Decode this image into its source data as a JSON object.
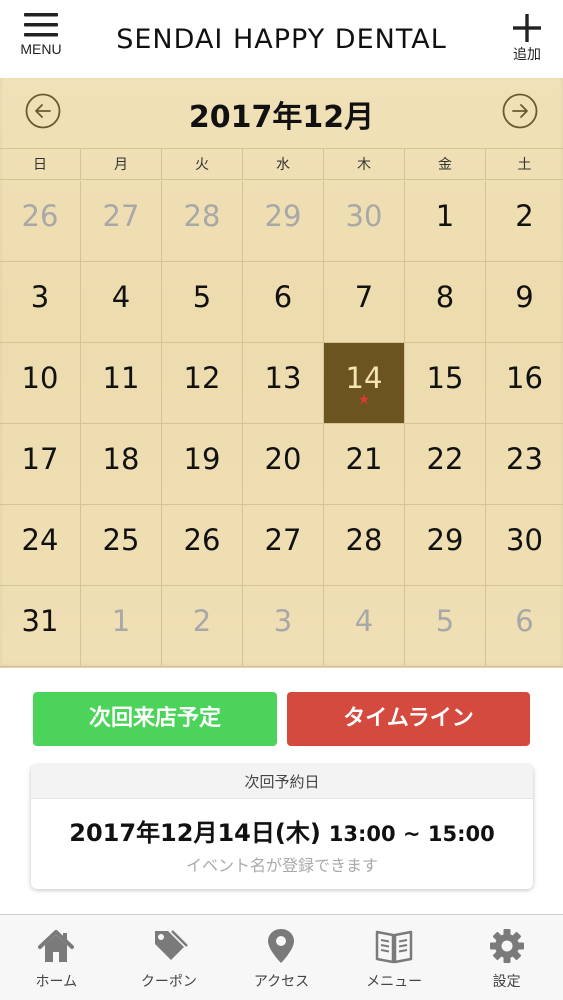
{
  "header": {
    "menu_label": "MENU",
    "title": "SENDAI HAPPY DENTAL",
    "add_label": "追加"
  },
  "calendar": {
    "month_title": "2017年12月",
    "weekdays": [
      "日",
      "月",
      "火",
      "水",
      "木",
      "金",
      "土"
    ],
    "weeks": [
      [
        "26",
        "27",
        "28",
        "29",
        "30",
        "1",
        "2"
      ],
      [
        "3",
        "4",
        "5",
        "6",
        "7",
        "8",
        "9"
      ],
      [
        "10",
        "11",
        "12",
        "13",
        "14",
        "15",
        "16"
      ],
      [
        "17",
        "18",
        "19",
        "20",
        "21",
        "22",
        "23"
      ],
      [
        "24",
        "25",
        "26",
        "27",
        "28",
        "29",
        "30"
      ],
      [
        "31",
        "1",
        "2",
        "3",
        "4",
        "5",
        "6"
      ]
    ],
    "other_month_cells": [
      [
        0,
        0
      ],
      [
        0,
        1
      ],
      [
        0,
        2
      ],
      [
        0,
        3
      ],
      [
        0,
        4
      ],
      [
        5,
        1
      ],
      [
        5,
        2
      ],
      [
        5,
        3
      ],
      [
        5,
        4
      ],
      [
        5,
        5
      ],
      [
        5,
        6
      ]
    ],
    "selected_cell": [
      2,
      4
    ],
    "marker": "★"
  },
  "buttons": {
    "next_visit": "次回来店予定",
    "timeline": "タイムライン"
  },
  "reservation": {
    "label": "次回予約日",
    "date": "2017年12月14日(木)",
    "time": "13:00 ~ 15:00",
    "event_placeholder": "イベント名が登録できます"
  },
  "tabbar": {
    "items": [
      {
        "label": "ホーム",
        "icon": "home-icon"
      },
      {
        "label": "クーポン",
        "icon": "coupon-tag-icon"
      },
      {
        "label": "アクセス",
        "icon": "map-pin-icon"
      },
      {
        "label": "メニュー",
        "icon": "book-icon"
      },
      {
        "label": "設定",
        "icon": "gear-icon"
      }
    ]
  },
  "colors": {
    "calendar_bg": "#efdfb4",
    "selected_day": "#6c5420",
    "marker_star": "#d83b2f",
    "next_visit_button": "#4cd45a",
    "timeline_button": "#d54a3e"
  }
}
